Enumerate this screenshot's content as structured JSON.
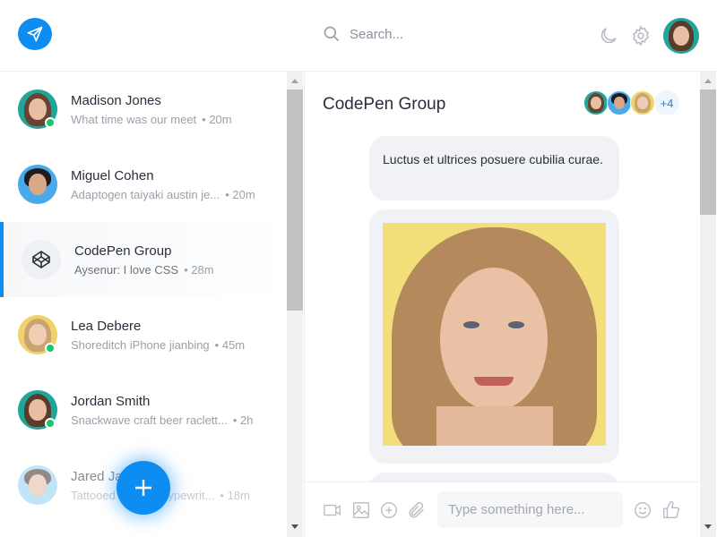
{
  "header": {
    "search_placeholder": "Search...",
    "icons": [
      "paper-plane-icon",
      "search-icon",
      "moon-icon",
      "gear-icon"
    ]
  },
  "colors": {
    "accent": "#0d8cf1",
    "online": "#20c36a",
    "bubble": "#f1f2f5"
  },
  "conversations": [
    {
      "name": "Madison Jones",
      "message": "What time was our meet",
      "time": "• 20m",
      "online": true
    },
    {
      "name": "Miguel Cohen",
      "message": "Adaptogen taiyaki austin je...",
      "time": "• 20m",
      "online": false
    },
    {
      "name": "CodePen Group",
      "message": "Aysenur: I love CSS",
      "time": "• 28m",
      "online": false,
      "active": true
    },
    {
      "name": "Lea Debere",
      "message": "Shoreditch iPhone jianbing",
      "time": "• 45m",
      "online": true
    },
    {
      "name": "Jordan Smith",
      "message": "Snackwave craft beer raclett...",
      "time": "• 2h",
      "online": true
    },
    {
      "name": "Jared Jackson",
      "message": "Tattooed art party typewrit...",
      "time": "• 18m",
      "online": false
    }
  ],
  "chat": {
    "title": "CodePen Group",
    "more_members": "+4",
    "messages": [
      {
        "text": "Luctus et ultrices posuere cubilia curae."
      }
    ]
  },
  "composer": {
    "placeholder": "Type something here...",
    "icons": [
      "video-icon",
      "image-icon",
      "plus-circle-icon",
      "paperclip-icon",
      "smile-icon",
      "thumbs-up-icon"
    ]
  }
}
